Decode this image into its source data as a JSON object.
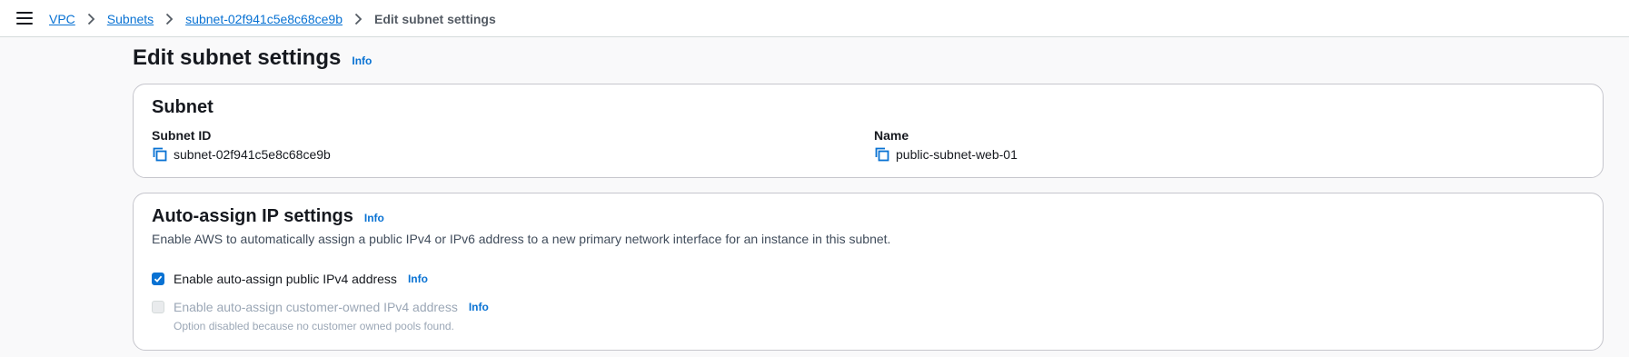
{
  "breadcrumb": {
    "items": [
      "VPC",
      "Subnets",
      "subnet-02f941c5e8c68ce9b"
    ],
    "current": "Edit subnet settings"
  },
  "page": {
    "title": "Edit subnet settings",
    "info": "Info"
  },
  "subnet_card": {
    "title": "Subnet",
    "subnet_id_label": "Subnet ID",
    "subnet_id_value": "subnet-02f941c5e8c68ce9b",
    "name_label": "Name",
    "name_value": "public-subnet-web-01"
  },
  "auto_assign": {
    "title": "Auto-assign IP settings",
    "info": "Info",
    "description": "Enable AWS to automatically assign a public IPv4 or IPv6 address to a new primary network interface for an instance in this subnet.",
    "options": [
      {
        "label": "Enable auto-assign public IPv4 address",
        "checked": true,
        "disabled": false,
        "info": "Info"
      },
      {
        "label": "Enable auto-assign customer-owned IPv4 address",
        "checked": false,
        "disabled": true,
        "info": "Info",
        "note": "Option disabled because no customer owned pools found."
      }
    ]
  },
  "colors": {
    "link": "#0972d3",
    "text": "#16191f",
    "muted": "#9ba7b6",
    "border": "#c6c6cd",
    "background": "#f9f9fa"
  }
}
